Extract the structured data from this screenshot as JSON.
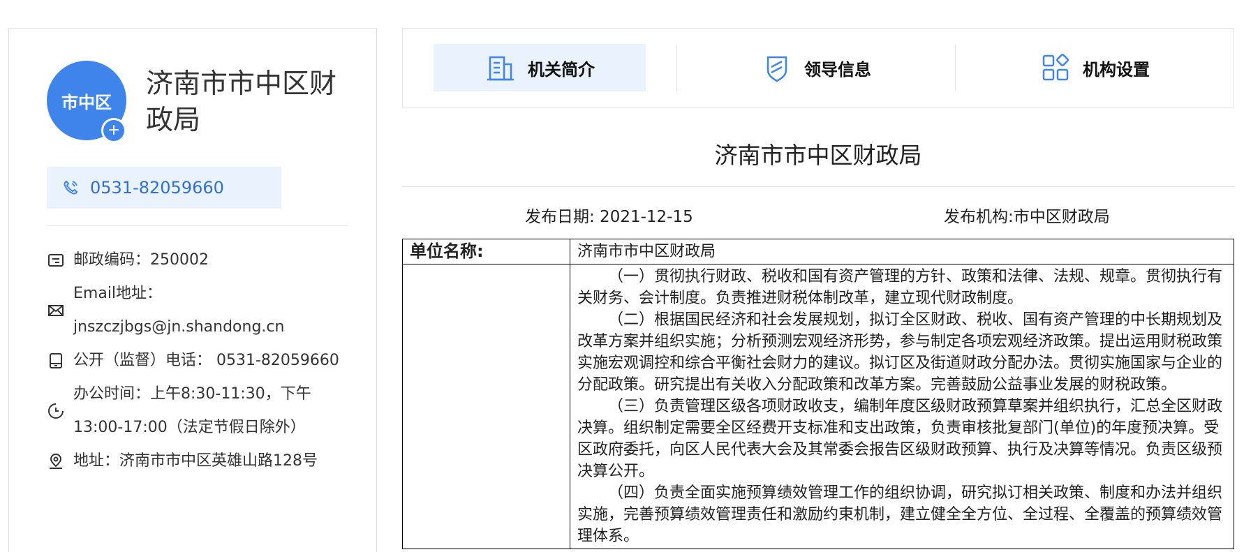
{
  "profile": {
    "avatar_text": "市中区",
    "avatar_plus": "+",
    "name": "济南市市中区财政局",
    "phone": "0531-82059660",
    "info": [
      {
        "icon": "postcode-icon",
        "text": "邮政编码：250002"
      },
      {
        "icon": "mail-icon",
        "text": "Email地址：jnszczjbgs@jn.shandong.cn"
      },
      {
        "icon": "supervision-phone-icon",
        "text": "公开（监督）电话： 0531-82059660"
      },
      {
        "icon": "clock-icon",
        "text": "办公时间：上午8:30-11:30，下午13:00-17:00（法定节假日除外）"
      },
      {
        "icon": "location-icon",
        "text": "地址：济南市市中区英雄山路128号"
      }
    ]
  },
  "tabs": [
    {
      "label": "机关简介",
      "icon": "document-icon",
      "active": true
    },
    {
      "label": "领导信息",
      "icon": "badge-icon",
      "active": false
    },
    {
      "label": "机构设置",
      "icon": "org-structure-icon",
      "active": false
    }
  ],
  "article": {
    "title": "济南市市中区财政局",
    "date_label": "发布日期: 2021-12-15",
    "publisher_label": "发布机构:市中区财政局",
    "table": {
      "unit_label": "单位名称:",
      "unit_value": "济南市市中区财政局",
      "duties": [
        "（一）贯彻执行财政、税收和国有资产管理的方针、政策和法律、法规、规章。贯彻执行有关财务、会计制度。负责推进财税体制改革，建立现代财政制度。",
        "（二）根据国民经济和社会发展规划，拟订全区财政、税收、国有资产管理的中长期规划及改革方案并组织实施；分析预测宏观经济形势，参与制定各项宏观经济政策。提出运用财税政策实施宏观调控和综合平衡社会财力的建议。拟订区及街道财政分配办法。贯彻实施国家与企业的分配政策。研究提出有关收入分配政策和改革方案。完善鼓励公益事业发展的财税政策。",
        "（三）负责管理区级各项财政收支，编制年度区级财政预算草案并组织执行，汇总全区财政决算。组织制定需要全区经费开支标准和支出政策，负责审核批复部门(单位)的年度预决算。受区政府委托，向区人民代表大会及其常委会报告区级财政预算、执行及决算等情况。负责区级预决算公开。",
        "（四）负责全面实施预算绩效管理工作的组织协调，研究拟订相关政策、制度和办法并组织实施，完善预算绩效管理责任和激励约束机制，建立健全全方位、全过程、全覆盖的预算绩效管理体系。"
      ]
    }
  },
  "colors": {
    "accent": "#3f84ea",
    "accent_light": "#eaf2fd",
    "phone_text": "#2f6fd7"
  }
}
